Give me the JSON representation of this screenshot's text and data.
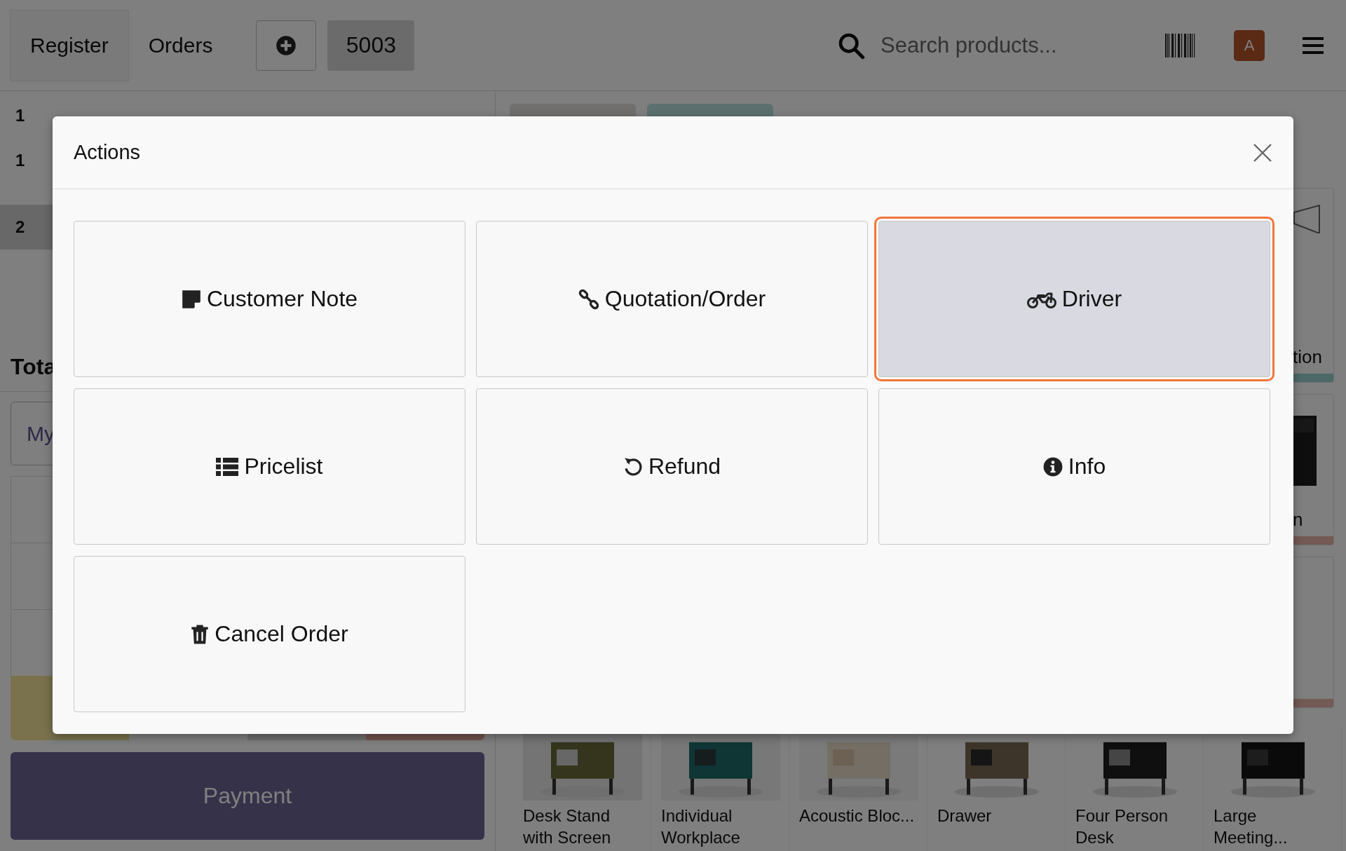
{
  "topbar": {
    "tabs": [
      {
        "label": "Register",
        "selected": true
      },
      {
        "label": "Orders",
        "selected": false
      }
    ],
    "order_number": "5003",
    "search": {
      "placeholder": "Search products..."
    },
    "user_initial": "A"
  },
  "order_lines": [
    {
      "quantity": "1",
      "selected": false
    },
    {
      "quantity": "1",
      "selected": false
    },
    {
      "quantity": "2",
      "selected": true
    }
  ],
  "total_label": "Tota",
  "customer_field": "My",
  "payment_button": "Payment",
  "side_products": [
    {
      "label": "tion",
      "kind": "outline"
    },
    {
      "label": "n",
      "kind": "picture"
    },
    {
      "kind": "blank"
    }
  ],
  "products": [
    {
      "name": "Desk Stand with Screen",
      "kind": "picture"
    },
    {
      "name": "Individual Workplace",
      "kind": "picture"
    },
    {
      "name": "Acoustic Bloc...",
      "kind": "picture"
    },
    {
      "name": "Drawer",
      "kind": "picture"
    },
    {
      "name": "Four Person Desk",
      "kind": "picture"
    },
    {
      "name": "Large Meeting...",
      "kind": "picture"
    }
  ],
  "dialog": {
    "title": "Actions",
    "actions": [
      {
        "label": "Customer Note",
        "kind": "note",
        "selected": false
      },
      {
        "label": "Quotation/Order",
        "kind": "link",
        "selected": false
      },
      {
        "label": "Driver",
        "kind": "motorcycle",
        "selected": true
      },
      {
        "label": "Pricelist",
        "kind": "list",
        "selected": false
      },
      {
        "label": "Refund",
        "kind": "undo",
        "selected": false
      },
      {
        "label": "Info",
        "kind": "info",
        "selected": false
      },
      {
        "label": "Cancel Order",
        "kind": "trash",
        "selected": false
      }
    ]
  }
}
